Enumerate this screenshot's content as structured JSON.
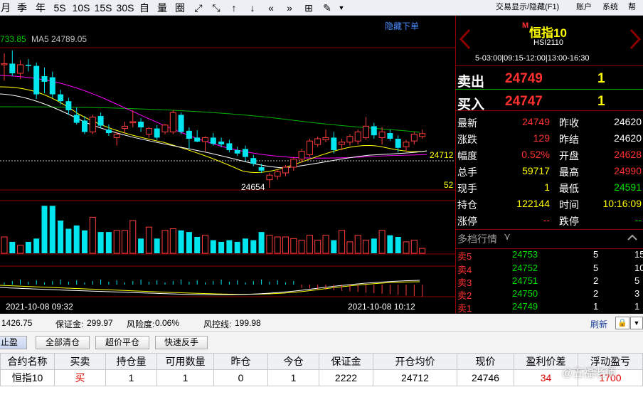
{
  "toolbar": {
    "periods": [
      "月",
      "季",
      "年",
      "5S",
      "10S",
      "15S",
      "30S",
      "自",
      "量",
      "圈"
    ],
    "icons": [
      "expand-icon",
      "shrink-icon",
      "arrow-up-icon",
      "arrow-down-icon",
      "double-left-icon",
      "double-right-icon",
      "grid-icon",
      "pen-icon",
      "dropdown-icon"
    ],
    "right_menu": [
      "交易显示/隐藏(F1)",
      "账户",
      "系统",
      "帮助"
    ]
  },
  "chart": {
    "ma_text_1": "733.85",
    "ma_text_2": "MA5 24789.05",
    "hide_order": "隐藏下单",
    "price_label": "24712",
    "low_label": "24654",
    "edge_label": "52",
    "date_left": "2021-10-08 09:32",
    "date_right": "2021-10-08 10:12"
  },
  "chart_data": {
    "type": "candlestick",
    "candles": [
      {
        "o": 24870,
        "h": 24890,
        "l": 24842,
        "c": 24872
      },
      {
        "o": 24872,
        "h": 24895,
        "l": 24850,
        "c": 24855
      },
      {
        "o": 24855,
        "h": 24878,
        "l": 24845,
        "c": 24870
      },
      {
        "o": 24870,
        "h": 24880,
        "l": 24858,
        "c": 24868
      },
      {
        "o": 24868,
        "h": 24874,
        "l": 24810,
        "c": 24818
      },
      {
        "o": 24850,
        "h": 24865,
        "l": 24820,
        "c": 24840
      },
      {
        "o": 24848,
        "h": 24858,
        "l": 24812,
        "c": 24818
      },
      {
        "o": 24818,
        "h": 24826,
        "l": 24800,
        "c": 24806
      },
      {
        "o": 24806,
        "h": 24812,
        "l": 24782,
        "c": 24790
      },
      {
        "o": 24782,
        "h": 24795,
        "l": 24765,
        "c": 24768
      },
      {
        "o": 24772,
        "h": 24780,
        "l": 24748,
        "c": 24752
      },
      {
        "o": 24752,
        "h": 24782,
        "l": 24748,
        "c": 24778
      },
      {
        "o": 24780,
        "h": 24786,
        "l": 24758,
        "c": 24763
      },
      {
        "o": 24756,
        "h": 24765,
        "l": 24745,
        "c": 24750
      },
      {
        "o": 24742,
        "h": 24752,
        "l": 24728,
        "c": 24748
      },
      {
        "o": 24758,
        "h": 24770,
        "l": 24750,
        "c": 24762
      },
      {
        "o": 24768,
        "h": 24790,
        "l": 24760,
        "c": 24770
      },
      {
        "o": 24770,
        "h": 24776,
        "l": 24752,
        "c": 24760
      },
      {
        "o": 24748,
        "h": 24760,
        "l": 24742,
        "c": 24758
      },
      {
        "o": 24758,
        "h": 24764,
        "l": 24738,
        "c": 24742
      },
      {
        "o": 24752,
        "h": 24766,
        "l": 24748,
        "c": 24764
      },
      {
        "o": 24752,
        "h": 24790,
        "l": 24748,
        "c": 24786
      },
      {
        "o": 24782,
        "h": 24786,
        "l": 24748,
        "c": 24752
      },
      {
        "o": 24754,
        "h": 24760,
        "l": 24722,
        "c": 24740
      },
      {
        "o": 24742,
        "h": 24755,
        "l": 24734,
        "c": 24735
      },
      {
        "o": 24735,
        "h": 24744,
        "l": 24718,
        "c": 24742
      },
      {
        "o": 24742,
        "h": 24750,
        "l": 24728,
        "c": 24731
      },
      {
        "o": 24735,
        "h": 24742,
        "l": 24725,
        "c": 24730
      },
      {
        "o": 24732,
        "h": 24738,
        "l": 24716,
        "c": 24720
      },
      {
        "o": 24720,
        "h": 24726,
        "l": 24710,
        "c": 24714
      },
      {
        "o": 24722,
        "h": 24728,
        "l": 24700,
        "c": 24708
      },
      {
        "o": 24706,
        "h": 24712,
        "l": 24692,
        "c": 24696
      },
      {
        "o": 24690,
        "h": 24696,
        "l": 24680,
        "c": 24684
      },
      {
        "o": 24668,
        "h": 24680,
        "l": 24654,
        "c": 24676
      },
      {
        "o": 24674,
        "h": 24686,
        "l": 24668,
        "c": 24682
      },
      {
        "o": 24680,
        "h": 24694,
        "l": 24674,
        "c": 24690
      },
      {
        "o": 24690,
        "h": 24708,
        "l": 24684,
        "c": 24704
      },
      {
        "o": 24704,
        "h": 24722,
        "l": 24698,
        "c": 24718
      },
      {
        "o": 24712,
        "h": 24740,
        "l": 24708,
        "c": 24736
      },
      {
        "o": 24730,
        "h": 24744,
        "l": 24726,
        "c": 24740
      },
      {
        "o": 24738,
        "h": 24756,
        "l": 24734,
        "c": 24742
      },
      {
        "o": 24742,
        "h": 24752,
        "l": 24714,
        "c": 24720
      },
      {
        "o": 24730,
        "h": 24740,
        "l": 24720,
        "c": 24734
      },
      {
        "o": 24734,
        "h": 24748,
        "l": 24728,
        "c": 24744
      },
      {
        "o": 24736,
        "h": 24756,
        "l": 24730,
        "c": 24752
      },
      {
        "o": 24742,
        "h": 24778,
        "l": 24738,
        "c": 24762
      },
      {
        "o": 24762,
        "h": 24768,
        "l": 24740,
        "c": 24746
      },
      {
        "o": 24742,
        "h": 24760,
        "l": 24730,
        "c": 24752
      },
      {
        "o": 24750,
        "h": 24756,
        "l": 24736,
        "c": 24740
      },
      {
        "o": 24740,
        "h": 24746,
        "l": 24716,
        "c": 24724
      },
      {
        "o": 24726,
        "h": 24738,
        "l": 24718,
        "c": 24734
      },
      {
        "o": 24736,
        "h": 24752,
        "l": 24730,
        "c": 24748
      },
      {
        "o": 24744,
        "h": 24756,
        "l": 24740,
        "c": 24749
      }
    ],
    "volume": [
      20,
      14,
      10,
      14,
      18,
      58,
      58,
      40,
      30,
      34,
      28,
      44,
      26,
      26,
      28,
      28,
      40,
      18,
      32,
      18,
      28,
      30,
      28,
      26,
      20,
      22,
      16,
      14,
      16,
      14,
      18,
      16,
      26,
      22,
      20,
      20,
      18,
      16,
      22,
      16,
      22,
      16,
      28,
      14,
      22,
      16,
      18,
      28,
      22,
      20,
      14,
      16,
      6
    ],
    "ylim": [
      24650,
      24900
    ]
  },
  "quote": {
    "marker": "M",
    "name": "恒指10",
    "code": "HSI2110",
    "session": "5-03:00|09:15-12:00|13:00-16:30",
    "sell_label": "卖出",
    "sell_price": "24749",
    "sell_qty": "1",
    "buy_label": "买入",
    "buy_price": "24747",
    "buy_qty": "1",
    "rows": [
      [
        "最新",
        "24749",
        "昨收",
        "24620"
      ],
      [
        "涨跌",
        "129",
        "昨结",
        "24620"
      ],
      [
        "幅度",
        "0.52%",
        "开盘",
        "24628"
      ],
      [
        "总手",
        "59717",
        "最高",
        "24990"
      ],
      [
        "现手",
        "1",
        "最低",
        "24591"
      ],
      [
        "持仓",
        "122144",
        "时间",
        "10:16:09"
      ],
      [
        "涨停",
        "--",
        "跌停",
        "--"
      ]
    ],
    "depth_title": "多档行情",
    "depth": [
      [
        "卖5",
        "24753",
        "5",
        "15"
      ],
      [
        "卖4",
        "24752",
        "5",
        "10"
      ],
      [
        "卖3",
        "24751",
        "2",
        "5"
      ],
      [
        "卖2",
        "24750",
        "2",
        "3"
      ],
      [
        "卖1",
        "24749",
        "1",
        "1"
      ]
    ]
  },
  "account": {
    "balance_tail": "1426.75",
    "margin_label": "保证金:",
    "margin_value": "299.97",
    "risk_label": "风险度:",
    "risk_value": "0.06%",
    "control_label": "风控线:",
    "control_value": "199.98",
    "refresh": "刷新"
  },
  "buttons": [
    "止盈",
    "全部清仓",
    "超价平仓",
    "快速反手"
  ],
  "positions": {
    "headers": [
      "合约名称",
      "买卖",
      "持仓量",
      "可用数量",
      "昨仓",
      "今仓",
      "保证金",
      "开仓均价",
      "现价",
      "盈利价差",
      "浮动盈亏"
    ],
    "rows": [
      [
        "恒指10",
        "买",
        "1",
        "1",
        "0",
        "1",
        "2222",
        "24712",
        "24746",
        "34",
        "1700"
      ]
    ]
  },
  "watermark": "@五福老师"
}
